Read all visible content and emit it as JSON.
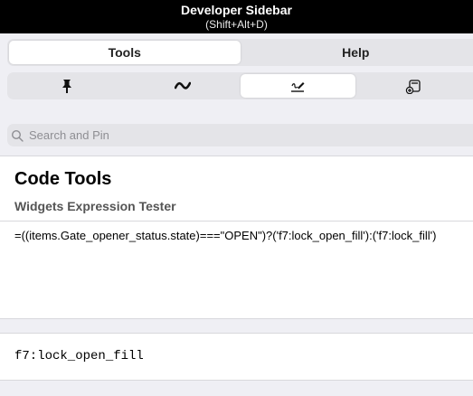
{
  "titlebar": {
    "title": "Developer Sidebar",
    "shortcut": "(Shift+Alt+D)"
  },
  "main_tabs": [
    {
      "label": "Tools",
      "active": true
    },
    {
      "label": "Help",
      "active": false
    }
  ],
  "tool_tabs": [
    {
      "icon": "pin-icon",
      "active": false
    },
    {
      "icon": "wave-icon",
      "active": false
    },
    {
      "icon": "signature-icon",
      "active": true
    },
    {
      "icon": "add-widget-icon",
      "active": false
    }
  ],
  "search": {
    "placeholder": "Search and Pin",
    "value": ""
  },
  "page": {
    "title": "Code Tools",
    "subtitle": "Widgets Expression Tester"
  },
  "expression": "=((items.Gate_opener_status.state)===\"OPEN\")?('f7:lock_open_fill'):('f7:lock_fill')",
  "result": "f7:lock_open_fill",
  "colors": {
    "titlebar": "#000000",
    "background": "#efeff4",
    "segment": "#e4e4e8"
  }
}
